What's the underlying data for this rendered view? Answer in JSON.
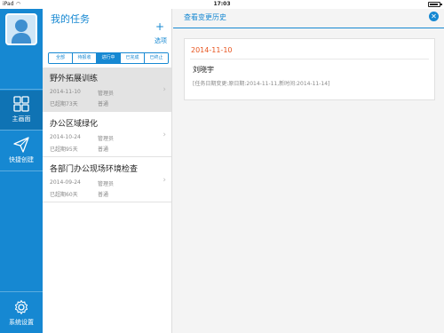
{
  "status_bar": {
    "carrier": "iPad",
    "time": "17:03",
    "battery_level": 0.7
  },
  "nav": {
    "items": [
      {
        "label": "主画面"
      },
      {
        "label": "快捷创建"
      },
      {
        "label": "系统设置"
      }
    ]
  },
  "task_panel": {
    "title": "我的任务",
    "add_glyph": "+",
    "options_label": "选项",
    "filters": [
      "全部",
      "待报收",
      "进行中",
      "已完成",
      "已终止"
    ],
    "active_filter": "进行中",
    "tasks": [
      {
        "name": "野外拓展训练",
        "date": "2014-11-10",
        "role": "管理员",
        "overdue": "已超期73天",
        "priority": "普通"
      },
      {
        "name": "办公区域绿化",
        "date": "2014-10-24",
        "role": "管理员",
        "overdue": "已超期95天",
        "priority": "普通"
      },
      {
        "name": "各部门办公现场环境检查",
        "date": "2014-09-24",
        "role": "管理员",
        "overdue": "已超期60天",
        "priority": "普通"
      }
    ]
  },
  "detail": {
    "title": "查看变更历史",
    "entries": [
      {
        "date": "2014-11-10",
        "person": "刘晓宇",
        "change": "[任务日期变更:原日期:2014-11-11,新时间:2014-11-14]"
      }
    ]
  },
  "colors": {
    "accent": "#1688d2",
    "date_highlight": "#e8541e",
    "selected_row": "#e3e3e3"
  }
}
